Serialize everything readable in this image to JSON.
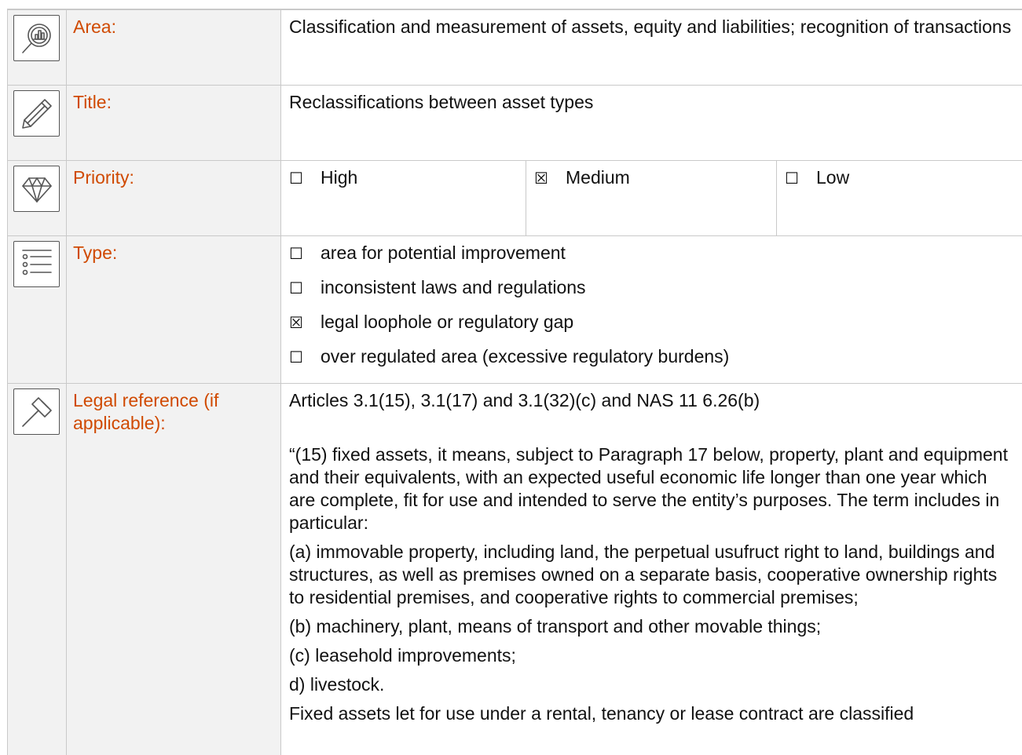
{
  "rows": {
    "area": {
      "label": "Area:",
      "value": "Classification and measurement of assets, equity and liabilities; recognition of transactions",
      "icon": "magnifier-chart-icon"
    },
    "title": {
      "label": "Title:",
      "value": "Reclassifications between asset types",
      "icon": "pencil-icon"
    },
    "priority": {
      "label": "Priority:",
      "icon": "diamond-icon",
      "options": [
        {
          "box": "☐",
          "label": "High"
        },
        {
          "box": "☒",
          "label": "Medium"
        },
        {
          "box": "☐",
          "label": "Low"
        }
      ]
    },
    "type": {
      "label": "Type:",
      "icon": "list-icon",
      "options": [
        {
          "box": "☐",
          "label": "area for potential improvement"
        },
        {
          "box": "☐",
          "label": "inconsistent laws and regulations"
        },
        {
          "box": "☒",
          "label": "legal loophole or regulatory gap"
        },
        {
          "box": "☐",
          "label": "over regulated area (excessive regulatory burdens)"
        }
      ]
    },
    "legal": {
      "label": "Legal reference (if applicable):",
      "icon": "gavel-icon",
      "reference": "Articles 3.1(15), 3.1(17) and 3.1(32)(c) and NAS 11 6.26(b)",
      "paragraphs": [
        "“(15) fixed assets, it means, subject to Paragraph 17 below, property, plant and equipment and their equivalents, with an expected useful economic life longer than one year which are complete, fit for use and intended to serve the entity’s purposes. The term includes in particular:",
        "(a) immovable property, including land, the perpetual usufruct right to land, buildings and structures, as well as premises owned on a separate basis, cooperative ownership rights to residential premises, and cooperative rights to commercial premises;",
        "(b) machinery, plant, means of transport and other movable things;",
        "(c) leasehold improvements;",
        "d) livestock.",
        "Fixed assets let for use under a rental, tenancy or lease contract are classified"
      ]
    }
  },
  "colors": {
    "label_color": "#d04a02",
    "label_bg": "#f2f2f2",
    "border": "#c9c9c9"
  }
}
